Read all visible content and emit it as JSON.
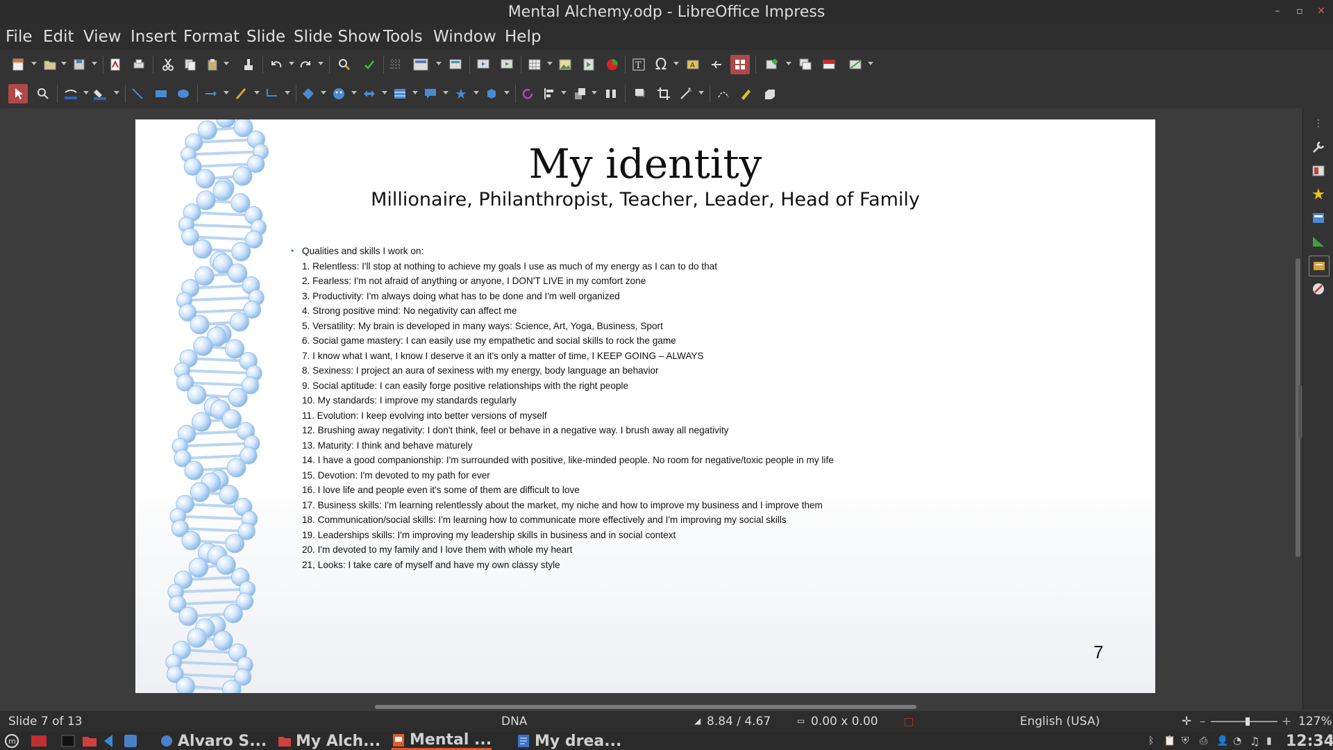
{
  "window": {
    "title": "Mental Alchemy.odp - LibreOffice Impress"
  },
  "menu": [
    "File",
    "Edit",
    "View",
    "Insert",
    "Format",
    "Slide",
    "Slide Show",
    "Tools",
    "Window",
    "Help"
  ],
  "slide": {
    "title": "My identity",
    "subtitle": "Millionaire, Philanthropist, Teacher, Leader, Head of Family",
    "bullet_heading": "Qualities and skills I work on:",
    "items": [
      "1. Relentless: I'll stop at nothing to achieve my goals I use as much of my energy as I can to do that",
      "2. Fearless: I'm not afraid of anything or anyone, I DON'T LIVE in my comfort zone",
      "3. Productivity: I'm always doing what has to be done and I'm well organized",
      "4. Strong positive mind: No negativity can affect me",
      "5. Versatility: My brain is developed in many ways: Science, Art, Yoga, Business, Sport",
      "6. Social game mastery: I can easily use my empathetic and social skills to rock the game",
      "7. I know what I want, I know I deserve it an it's only a matter of time, I KEEP GOING – ALWAYS",
      "8. Sexiness: I project an aura of sexiness with my energy, body language an behavior",
      "9. Social aptitude: I can easily forge positive relationships with the right people",
      "10. My standards: I improve my standards regularly",
      "11. Evolution: I keep evolving into better versions of myself",
      "12. Brushing away negativity: I don't think, feel or behave in a negative way. I brush away all negativity",
      "13. Maturity: I think and behave maturely",
      "14. I have a good companionship: I'm surrounded with positive, like-minded people. No room for negative/toxic people in my life",
      "15. Devotion: I'm devoted to my path for ever",
      "16. I love life and people even it's some of them are difficult to love",
      "17. Business skills: I'm learning relentlessly about the market, my niche and how to improve my business and I improve them",
      "18. Communication/social skills: I'm learning how to communicate more effectively and I'm improving my social skills",
      "19. Leaderships skills: I'm improving my leadership skills in business and in social context",
      "20. I'm devoted to my family and I love them with whole my heart",
      "21, Looks: I take care of myself and have my own classy style"
    ],
    "page_number": "7"
  },
  "status": {
    "slide": "Slide 7 of 13",
    "layout": "DNA",
    "position": "8.84 / 4.67",
    "size": "0.00 x 0.00",
    "language": "English (USA)",
    "zoom": "127%",
    "zoom_level": 0.55
  },
  "taskbar": {
    "items": [
      "Alvaro S...",
      "My Alch...",
      "Mental ...",
      "My drea..."
    ],
    "clock": "12:34"
  },
  "colors": {
    "accent": "#e05a2a",
    "selected": "#c0392b",
    "bullet": "#3a6fc4"
  }
}
